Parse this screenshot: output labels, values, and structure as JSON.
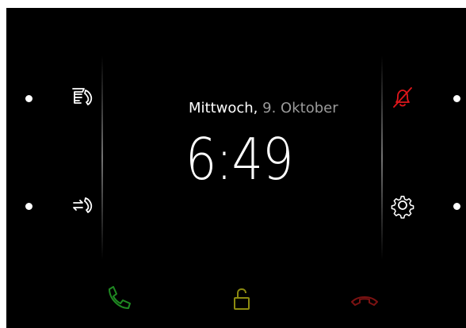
{
  "clock": {
    "weekday": "Mittwoch,",
    "date": "9. Oktober",
    "time": "6:49"
  },
  "icons": {
    "left_top": "message-call-icon",
    "left_bottom": "call-forward-icon",
    "right_top": "bell-muted-icon",
    "right_bottom": "settings-gear-icon",
    "accept": "phone-accept-icon",
    "unlock": "door-unlock-icon",
    "hangup": "phone-hangup-icon"
  },
  "colors": {
    "background": "#000000",
    "text": "#ffffff",
    "date_secondary": "#9a9a9a",
    "mute_red": "#e0161b",
    "accept_green": "#1f8a22",
    "unlock_olive": "#8c8a10",
    "hangup_red": "#7a1212"
  }
}
